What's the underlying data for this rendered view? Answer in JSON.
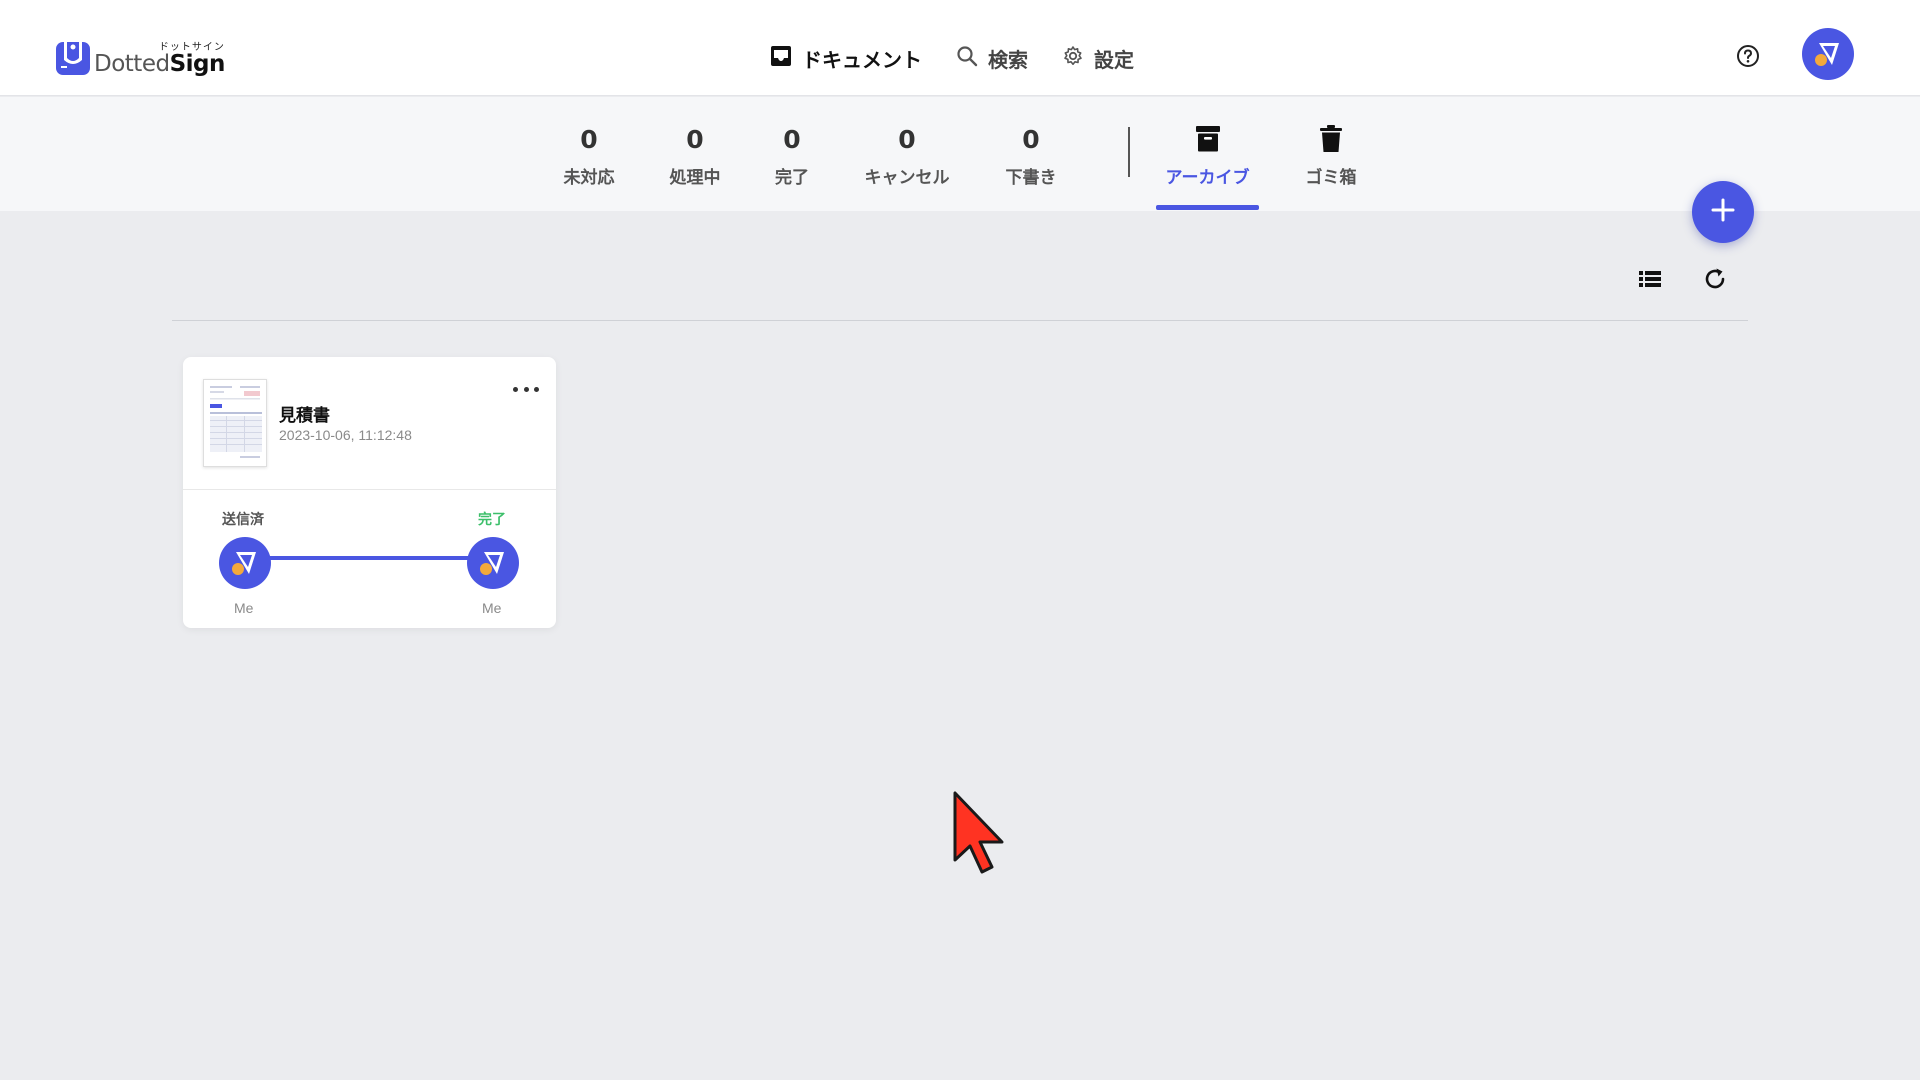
{
  "brand": {
    "kana": "ドットサイン",
    "name_light": "Dotted",
    "name_bold": "Sign",
    "logo_color": "#4a56e2"
  },
  "nav": {
    "items": [
      {
        "label": "ドキュメント",
        "icon": "inbox-icon"
      },
      {
        "label": "検索",
        "icon": "search-icon"
      },
      {
        "label": "設定",
        "icon": "gear-icon"
      }
    ],
    "help_icon": "help-circle-icon"
  },
  "status_tabs": [
    {
      "count": "0",
      "label": "未対応"
    },
    {
      "count": "0",
      "label": "処理中"
    },
    {
      "count": "0",
      "label": "完了"
    },
    {
      "count": "0",
      "label": "キャンセル"
    },
    {
      "count": "0",
      "label": "下書き"
    }
  ],
  "icon_tabs": [
    {
      "label": "アーカイブ",
      "icon": "archive-box-icon",
      "active": true
    },
    {
      "label": "ゴミ箱",
      "icon": "trash-icon",
      "active": false
    }
  ],
  "toolbar": {
    "list_view_icon": "list-view-icon",
    "refresh_icon": "refresh-icon",
    "fab_icon": "plus-icon"
  },
  "documents": [
    {
      "title": "見積書",
      "date": "2023-10-06, 11:12:48",
      "menu_icon": "more-horizontal-icon",
      "progress": {
        "start_label": "送信済",
        "end_label": "完了",
        "start_user": "Me",
        "end_user": "Me"
      }
    }
  ],
  "colors": {
    "accent": "#4a56e2",
    "success": "#3cbf6a",
    "avatar_dot": "#f3a93c",
    "background": "#ebecef"
  }
}
